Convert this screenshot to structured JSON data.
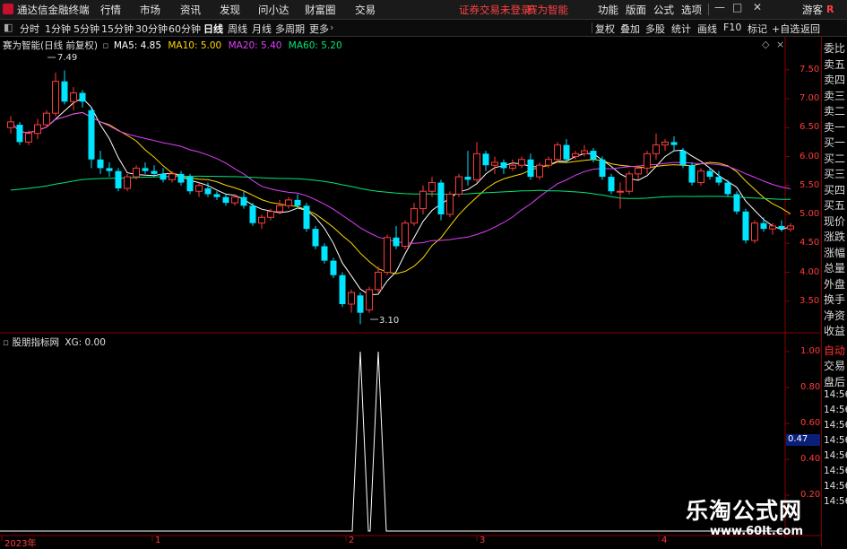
{
  "menu": {
    "brand": "通达信金融终端",
    "items": [
      "行情",
      "市场",
      "资讯",
      "发现",
      "问小达",
      "财富圈",
      "交易"
    ],
    "notice": "证券交易未登录",
    "product": "赛为智能",
    "right_items": [
      "功能",
      "版面",
      "公式",
      "选项"
    ],
    "guest": "游客",
    "r_badge": "R"
  },
  "toolbar": {
    "periods": [
      "分时",
      "1分钟",
      "5分钟",
      "15分钟",
      "30分钟",
      "60分钟",
      "日线",
      "周线",
      "月线",
      "多周期",
      "更多"
    ],
    "active_period": "日线",
    "right_buttons": [
      "复权",
      "叠加",
      "多股",
      "统计",
      "画线",
      "F10",
      "标记",
      "+自选",
      "返回"
    ]
  },
  "main_legend": {
    "title": "赛为智能(日线 前复权)",
    "ma5": "MA5: 4.85",
    "ma10": "MA10: 5.00",
    "ma20": "MA20: 5.40",
    "ma60": "MA60: 5.20",
    "high_label": "7.49",
    "low_label": "3.10"
  },
  "sub_legend": {
    "title": "股朋指标网",
    "xg": "XG: 0.00",
    "marker": "0.47"
  },
  "price_axis": [
    "7.50",
    "7.00",
    "6.50",
    "6.00",
    "5.50",
    "5.00",
    "4.50",
    "4.00",
    "3.50"
  ],
  "sub_axis": [
    "1.00",
    "0.80",
    "0.60",
    "0.40",
    "0.20"
  ],
  "date_axis": [
    "2023年",
    "1",
    "2",
    "3",
    "4"
  ],
  "right_panel": {
    "items": [
      "委比",
      "卖五",
      "卖四",
      "卖三",
      "卖二",
      "卖一",
      "买一",
      "买二",
      "买三",
      "买四",
      "买五",
      "现价",
      "涨跌",
      "涨幅",
      "总量",
      "外盘",
      "换手",
      "净资",
      "收益"
    ],
    "trade_items": [
      "自动",
      "交易",
      "盘后"
    ],
    "times": [
      "14:56",
      "14:56",
      "14:56",
      "14:56",
      "14:56",
      "14:56",
      "14:56",
      "14:56"
    ]
  },
  "watermark": {
    "line1": "乐淘公式网",
    "line2": "www.60lt.com"
  },
  "colors": {
    "up": "#ff3b3b",
    "down": "#00e5ff",
    "ma5": "#ffffff",
    "ma10": "#ffd700",
    "ma20": "#e040fb",
    "ma60": "#00e676",
    "indicator": "#ffffff"
  },
  "chart_data": {
    "type": "candlestick",
    "price_min": 3.0,
    "price_max": 7.9,
    "candles": [
      {
        "o": 6.5,
        "h": 6.7,
        "l": 6.4,
        "c": 6.6
      },
      {
        "o": 6.55,
        "h": 6.6,
        "l": 6.2,
        "c": 6.25
      },
      {
        "o": 6.25,
        "h": 6.45,
        "l": 6.2,
        "c": 6.4
      },
      {
        "o": 6.4,
        "h": 6.65,
        "l": 6.3,
        "c": 6.55
      },
      {
        "o": 6.55,
        "h": 6.8,
        "l": 6.5,
        "c": 6.75
      },
      {
        "o": 6.75,
        "h": 7.45,
        "l": 6.7,
        "c": 7.3
      },
      {
        "o": 7.3,
        "h": 7.49,
        "l": 6.9,
        "c": 6.95
      },
      {
        "o": 6.95,
        "h": 7.2,
        "l": 6.8,
        "c": 7.1
      },
      {
        "o": 7.1,
        "h": 7.15,
        "l": 6.85,
        "c": 6.95
      },
      {
        "o": 6.8,
        "h": 6.85,
        "l": 5.8,
        "c": 5.95
      },
      {
        "o": 5.95,
        "h": 6.1,
        "l": 5.7,
        "c": 5.8
      },
      {
        "o": 5.8,
        "h": 5.9,
        "l": 5.65,
        "c": 5.75
      },
      {
        "o": 5.75,
        "h": 5.8,
        "l": 5.4,
        "c": 5.45
      },
      {
        "o": 5.45,
        "h": 5.7,
        "l": 5.4,
        "c": 5.65
      },
      {
        "o": 5.65,
        "h": 5.85,
        "l": 5.6,
        "c": 5.8
      },
      {
        "o": 5.8,
        "h": 5.9,
        "l": 5.7,
        "c": 5.75
      },
      {
        "o": 5.75,
        "h": 5.85,
        "l": 5.65,
        "c": 5.7
      },
      {
        "o": 5.7,
        "h": 5.8,
        "l": 5.55,
        "c": 5.6
      },
      {
        "o": 5.6,
        "h": 5.75,
        "l": 5.55,
        "c": 5.7
      },
      {
        "o": 5.7,
        "h": 5.75,
        "l": 5.5,
        "c": 5.55
      },
      {
        "o": 5.65,
        "h": 5.7,
        "l": 5.35,
        "c": 5.4
      },
      {
        "o": 5.4,
        "h": 5.55,
        "l": 5.3,
        "c": 5.5
      },
      {
        "o": 5.45,
        "h": 5.55,
        "l": 5.3,
        "c": 5.35
      },
      {
        "o": 5.35,
        "h": 5.4,
        "l": 5.25,
        "c": 5.3
      },
      {
        "o": 5.3,
        "h": 5.35,
        "l": 5.15,
        "c": 5.2
      },
      {
        "o": 5.2,
        "h": 5.35,
        "l": 5.15,
        "c": 5.3
      },
      {
        "o": 5.3,
        "h": 5.4,
        "l": 5.1,
        "c": 5.15
      },
      {
        "o": 5.15,
        "h": 5.2,
        "l": 4.8,
        "c": 4.85
      },
      {
        "o": 4.85,
        "h": 5.0,
        "l": 4.75,
        "c": 4.95
      },
      {
        "o": 4.95,
        "h": 5.1,
        "l": 4.9,
        "c": 5.05
      },
      {
        "o": 5.05,
        "h": 5.25,
        "l": 5.0,
        "c": 5.15
      },
      {
        "o": 5.15,
        "h": 5.3,
        "l": 5.1,
        "c": 5.25
      },
      {
        "o": 5.25,
        "h": 5.35,
        "l": 5.1,
        "c": 5.15
      },
      {
        "o": 5.15,
        "h": 5.2,
        "l": 4.7,
        "c": 4.75
      },
      {
        "o": 4.75,
        "h": 4.8,
        "l": 4.4,
        "c": 4.45
      },
      {
        "o": 4.45,
        "h": 4.5,
        "l": 4.15,
        "c": 4.2
      },
      {
        "o": 4.2,
        "h": 4.25,
        "l": 3.9,
        "c": 3.95
      },
      {
        "o": 3.95,
        "h": 4.0,
        "l": 3.4,
        "c": 3.45
      },
      {
        "o": 3.45,
        "h": 3.7,
        "l": 3.3,
        "c": 3.65
      },
      {
        "o": 3.6,
        "h": 3.65,
        "l": 3.1,
        "c": 3.3
      },
      {
        "o": 3.35,
        "h": 3.75,
        "l": 3.3,
        "c": 3.7
      },
      {
        "o": 3.7,
        "h": 4.1,
        "l": 3.65,
        "c": 4.0
      },
      {
        "o": 4.0,
        "h": 4.65,
        "l": 3.95,
        "c": 4.6
      },
      {
        "o": 4.6,
        "h": 4.8,
        "l": 4.4,
        "c": 4.45
      },
      {
        "o": 4.45,
        "h": 4.9,
        "l": 4.4,
        "c": 4.85
      },
      {
        "o": 4.85,
        "h": 5.2,
        "l": 4.8,
        "c": 5.1
      },
      {
        "o": 5.1,
        "h": 5.5,
        "l": 5.0,
        "c": 5.4
      },
      {
        "o": 5.4,
        "h": 5.65,
        "l": 5.3,
        "c": 5.55
      },
      {
        "o": 5.55,
        "h": 5.6,
        "l": 4.9,
        "c": 5.0
      },
      {
        "o": 5.0,
        "h": 5.4,
        "l": 4.95,
        "c": 5.35
      },
      {
        "o": 5.35,
        "h": 5.7,
        "l": 5.3,
        "c": 5.65
      },
      {
        "o": 5.65,
        "h": 6.1,
        "l": 5.5,
        "c": 5.6
      },
      {
        "o": 5.6,
        "h": 6.25,
        "l": 5.55,
        "c": 6.05
      },
      {
        "o": 6.05,
        "h": 6.1,
        "l": 5.75,
        "c": 5.85
      },
      {
        "o": 5.85,
        "h": 6.0,
        "l": 5.7,
        "c": 5.9
      },
      {
        "o": 5.9,
        "h": 5.95,
        "l": 5.7,
        "c": 5.8
      },
      {
        "o": 5.8,
        "h": 5.95,
        "l": 5.75,
        "c": 5.85
      },
      {
        "o": 5.85,
        "h": 6.0,
        "l": 5.8,
        "c": 5.95
      },
      {
        "o": 5.95,
        "h": 6.05,
        "l": 5.6,
        "c": 5.65
      },
      {
        "o": 5.65,
        "h": 5.9,
        "l": 5.6,
        "c": 5.85
      },
      {
        "o": 5.85,
        "h": 6.0,
        "l": 5.8,
        "c": 5.95
      },
      {
        "o": 5.95,
        "h": 6.25,
        "l": 5.9,
        "c": 6.2
      },
      {
        "o": 6.2,
        "h": 6.3,
        "l": 5.9,
        "c": 5.95
      },
      {
        "o": 6.0,
        "h": 6.1,
        "l": 5.95,
        "c": 6.05
      },
      {
        "o": 6.05,
        "h": 6.2,
        "l": 6.0,
        "c": 6.1
      },
      {
        "o": 6.1,
        "h": 6.15,
        "l": 5.9,
        "c": 5.95
      },
      {
        "o": 5.95,
        "h": 6.0,
        "l": 5.6,
        "c": 5.65
      },
      {
        "o": 5.65,
        "h": 5.7,
        "l": 5.35,
        "c": 5.4
      },
      {
        "o": 5.4,
        "h": 5.55,
        "l": 5.1,
        "c": 5.4
      },
      {
        "o": 5.4,
        "h": 5.75,
        "l": 5.35,
        "c": 5.7
      },
      {
        "o": 5.7,
        "h": 5.85,
        "l": 5.6,
        "c": 5.8
      },
      {
        "o": 5.8,
        "h": 6.1,
        "l": 5.7,
        "c": 6.05
      },
      {
        "o": 6.05,
        "h": 6.4,
        "l": 5.95,
        "c": 6.2
      },
      {
        "o": 6.2,
        "h": 6.3,
        "l": 6.1,
        "c": 6.25
      },
      {
        "o": 6.25,
        "h": 6.35,
        "l": 6.1,
        "c": 6.2
      },
      {
        "o": 6.1,
        "h": 6.15,
        "l": 5.8,
        "c": 5.85
      },
      {
        "o": 5.85,
        "h": 5.9,
        "l": 5.5,
        "c": 5.55
      },
      {
        "o": 5.55,
        "h": 5.8,
        "l": 5.5,
        "c": 5.75
      },
      {
        "o": 5.75,
        "h": 5.8,
        "l": 5.6,
        "c": 5.65
      },
      {
        "o": 5.65,
        "h": 5.75,
        "l": 5.5,
        "c": 5.55
      },
      {
        "o": 5.55,
        "h": 5.6,
        "l": 5.3,
        "c": 5.35
      },
      {
        "o": 5.35,
        "h": 5.4,
        "l": 5.0,
        "c": 5.05
      },
      {
        "o": 5.05,
        "h": 5.1,
        "l": 4.5,
        "c": 4.55
      },
      {
        "o": 4.55,
        "h": 4.9,
        "l": 4.5,
        "c": 4.85
      },
      {
        "o": 4.85,
        "h": 4.95,
        "l": 4.7,
        "c": 4.75
      },
      {
        "o": 4.75,
        "h": 4.85,
        "l": 4.65,
        "c": 4.8
      },
      {
        "o": 4.8,
        "h": 4.9,
        "l": 4.7,
        "c": 4.75
      },
      {
        "o": 4.75,
        "h": 4.85,
        "l": 4.7,
        "c": 4.8
      }
    ],
    "xg_signals": [
      {
        "index": 39,
        "value": 1.0
      },
      {
        "index": 41,
        "value": 1.0
      }
    ]
  }
}
